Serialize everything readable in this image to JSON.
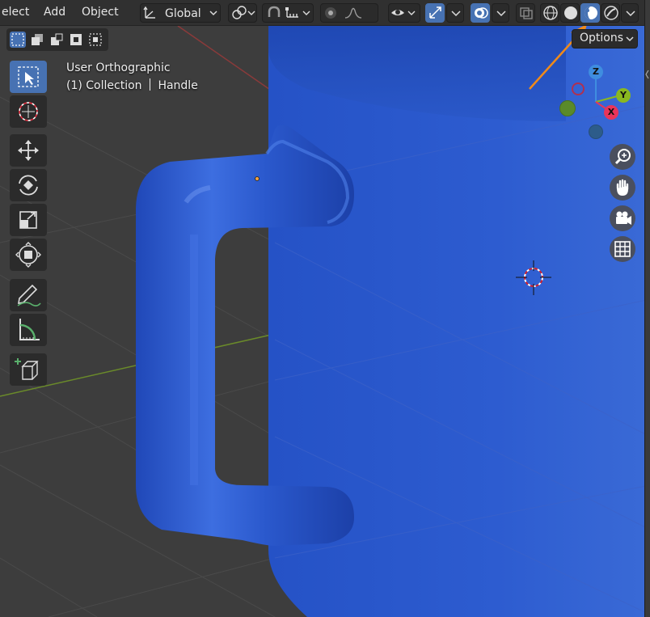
{
  "menu": {
    "select_label": "elect",
    "add_label": "Add",
    "object_label": "Object"
  },
  "header": {
    "orientation_label": "Global"
  },
  "options": {
    "label": "Options"
  },
  "viewport": {
    "view_name": "User Orthographic",
    "collection_label": "(1) Collection",
    "object_name": "Handle"
  },
  "gizmo": {
    "x_label": "X",
    "y_label": "Y",
    "z_label": "Z"
  },
  "colors": {
    "accent": "#4772b3",
    "header_bg": "#303030",
    "mug_blue": "#2f5fd0",
    "annotation_arrow": "#f08a1a",
    "x_axis": "#e8355a",
    "y_axis": "#8ab820",
    "z_axis": "#3f8de0"
  },
  "icons": {
    "transform_orientation": "orientation-icon",
    "pivot": "pivot-point-icon",
    "snap": "snap-magnet-icon",
    "proportional": "proportional-editing-icon",
    "visibility": "eye-icon",
    "gizmo": "gizmo-icon",
    "overlays": "overlays-icon",
    "xray": "xray-icon",
    "shading_wireframe": "wireframe-shading-icon",
    "shading_solid": "solid-shading-icon",
    "shading_material": "material-preview-icon",
    "shading_rendered": "rendered-shading-icon"
  },
  "active_shading_mode": "material-preview"
}
